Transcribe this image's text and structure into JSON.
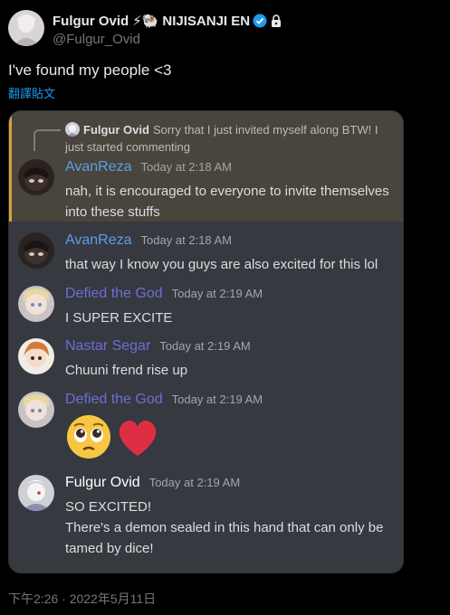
{
  "tweet": {
    "display_name": "Fulgur Ovid",
    "name_emojis": "⚡🐏",
    "org_label": "NIJISANJI EN",
    "handle": "@Fulgur_Ovid",
    "text": "I've found my people <3",
    "translate_label": "翻譯貼文",
    "timestamp": "下午2:26 · 2022年5月11日"
  },
  "discord": {
    "reply": {
      "author": "Fulgur Ovid",
      "text": "Sorry that I just invited myself along BTW! I just started commenting"
    },
    "messages": [
      {
        "author": "AvanReza",
        "time": "Today at 2:18 AM",
        "text": "nah, it is encouraged to everyone to invite themselves into these stuffs",
        "author_color": "#5d9ee8"
      },
      {
        "author": "AvanReza",
        "time": "Today at 2:18 AM",
        "text": "that way I know you guys are also excited for this lol",
        "author_color": "#5d9ee8"
      },
      {
        "author": "Defied the God",
        "time": "Today at 2:19 AM",
        "text": "I SUPER EXCITE",
        "author_color": "#6c6fd8"
      },
      {
        "author": "Nastar Segar",
        "time": "Today at 2:19 AM",
        "text": "Chuuni frend rise up",
        "author_color": "#6c6fd8"
      },
      {
        "author": "Defied the God",
        "time": "Today at 2:19 AM",
        "emojis": [
          "pleading-face",
          "red-heart"
        ],
        "author_color": "#6c6fd8"
      },
      {
        "author": "Fulgur Ovid",
        "time": "Today at 2:19 AM",
        "text": "SO EXCITED!",
        "text2": "There's a demon sealed in this hand that can only be tamed by dice!",
        "author_color": "#ffffff"
      }
    ]
  }
}
